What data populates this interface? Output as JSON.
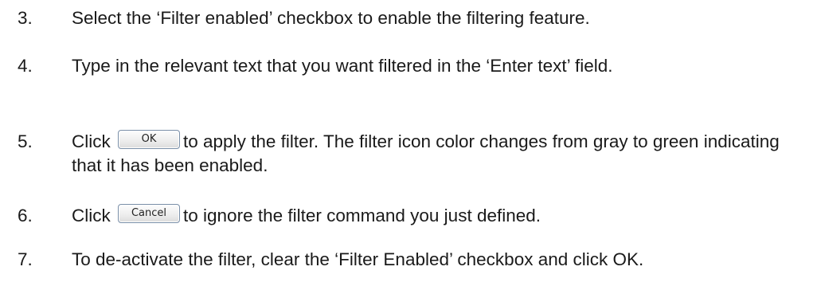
{
  "steps": [
    {
      "number": "3.",
      "text": "Select the ‘Filter enabled’ checkbox to enable the filtering feature."
    },
    {
      "number": "4.",
      "text": "Type in the relevant text that you want filtered in the ‘Enter text’ field."
    },
    {
      "number": "5.",
      "before": "Click",
      "button": "OK",
      "after": "to apply the filter. The filter icon color changes from gray to green indicating that it has been enabled."
    },
    {
      "number": "6.",
      "before": "Click",
      "button": "Cancel",
      "after": "to ignore the filter command you just defined."
    },
    {
      "number": "7.",
      "text": "To de-activate the filter, clear the ‘Filter Enabled’ checkbox and click OK."
    }
  ]
}
